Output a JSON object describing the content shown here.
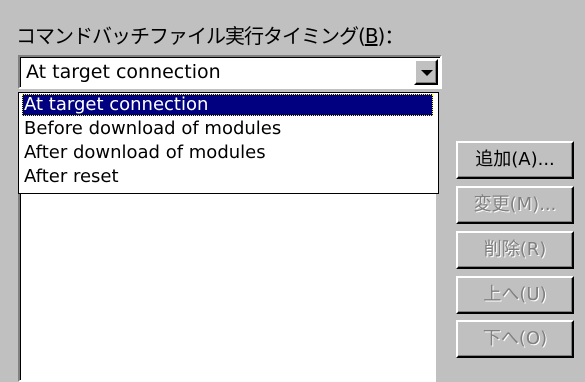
{
  "label": {
    "text": "コマンドバッチファイル実行タイミング(",
    "mnemonic": "B",
    "suffix": ")："
  },
  "combo": {
    "value": "At target connection",
    "button_icon": "dropdown-arrow-icon"
  },
  "dropdown": {
    "items": [
      "At target connection",
      "Before download of modules",
      "After download of modules",
      "After reset"
    ],
    "selected_index": 0
  },
  "buttons": {
    "add": "追加(A)...",
    "change": "変更(M)...",
    "delete": "削除(R)",
    "up": "上へ(U)",
    "down": "下へ(O)"
  },
  "colors": {
    "selection": "#000080",
    "face": "#c0c0c0"
  }
}
